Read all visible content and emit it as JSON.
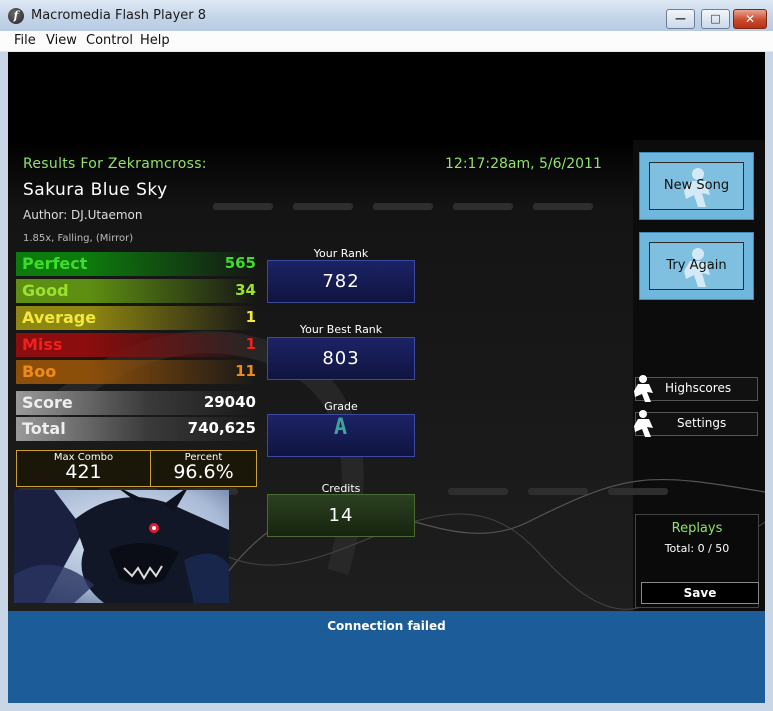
{
  "window": {
    "title": "Macromedia Flash Player 8",
    "min": "—",
    "max": "□",
    "close": "✕"
  },
  "menu": [
    "File",
    "View",
    "Control",
    "Help"
  ],
  "results": {
    "header": "Results For Zekramcross:",
    "timestamp": "12:17:28am, 5/6/2011",
    "song_title": "Sakura Blue Sky",
    "author": "Author: DJ.Utaemon",
    "modifiers": "1.85x, Falling, (Mirror)"
  },
  "judgements": [
    {
      "label": "Perfect",
      "value": "565",
      "color": "#3fdc2a",
      "bar": "#0d7a0d"
    },
    {
      "label": "Good",
      "value": "34",
      "color": "#9be22f",
      "bar": "#5e8f12"
    },
    {
      "label": "Average",
      "value": "1",
      "color": "#f3e93a",
      "bar": "#8f8712"
    },
    {
      "label": "Miss",
      "value": "1",
      "color": "#f02020",
      "bar": "#8c0d0d"
    },
    {
      "label": "Boo",
      "value": "11",
      "color": "#f08a18",
      "bar": "#8c4f0a"
    }
  ],
  "score": {
    "label": "Score",
    "value": "29040"
  },
  "total": {
    "label": "Total",
    "value": "740,625"
  },
  "combo": {
    "max_label": "Max Combo",
    "max_value": "421",
    "pct_label": "Percent",
    "pct_value": "96.6%"
  },
  "rank": {
    "your_rank_label": "Your Rank",
    "your_rank": "782",
    "best_rank_label": "Your Best Rank",
    "best_rank": "803",
    "grade_label": "Grade",
    "grade": "A",
    "credits_label": "Credits",
    "credits": "14"
  },
  "buttons": {
    "new_song": "New Song",
    "try_again": "Try Again",
    "highscores": "Highscores",
    "settings": "Settings"
  },
  "replays": {
    "title": "Replays",
    "count": "Total: 0 / 50",
    "save": "Save"
  },
  "status": {
    "message": "Connection failed"
  }
}
